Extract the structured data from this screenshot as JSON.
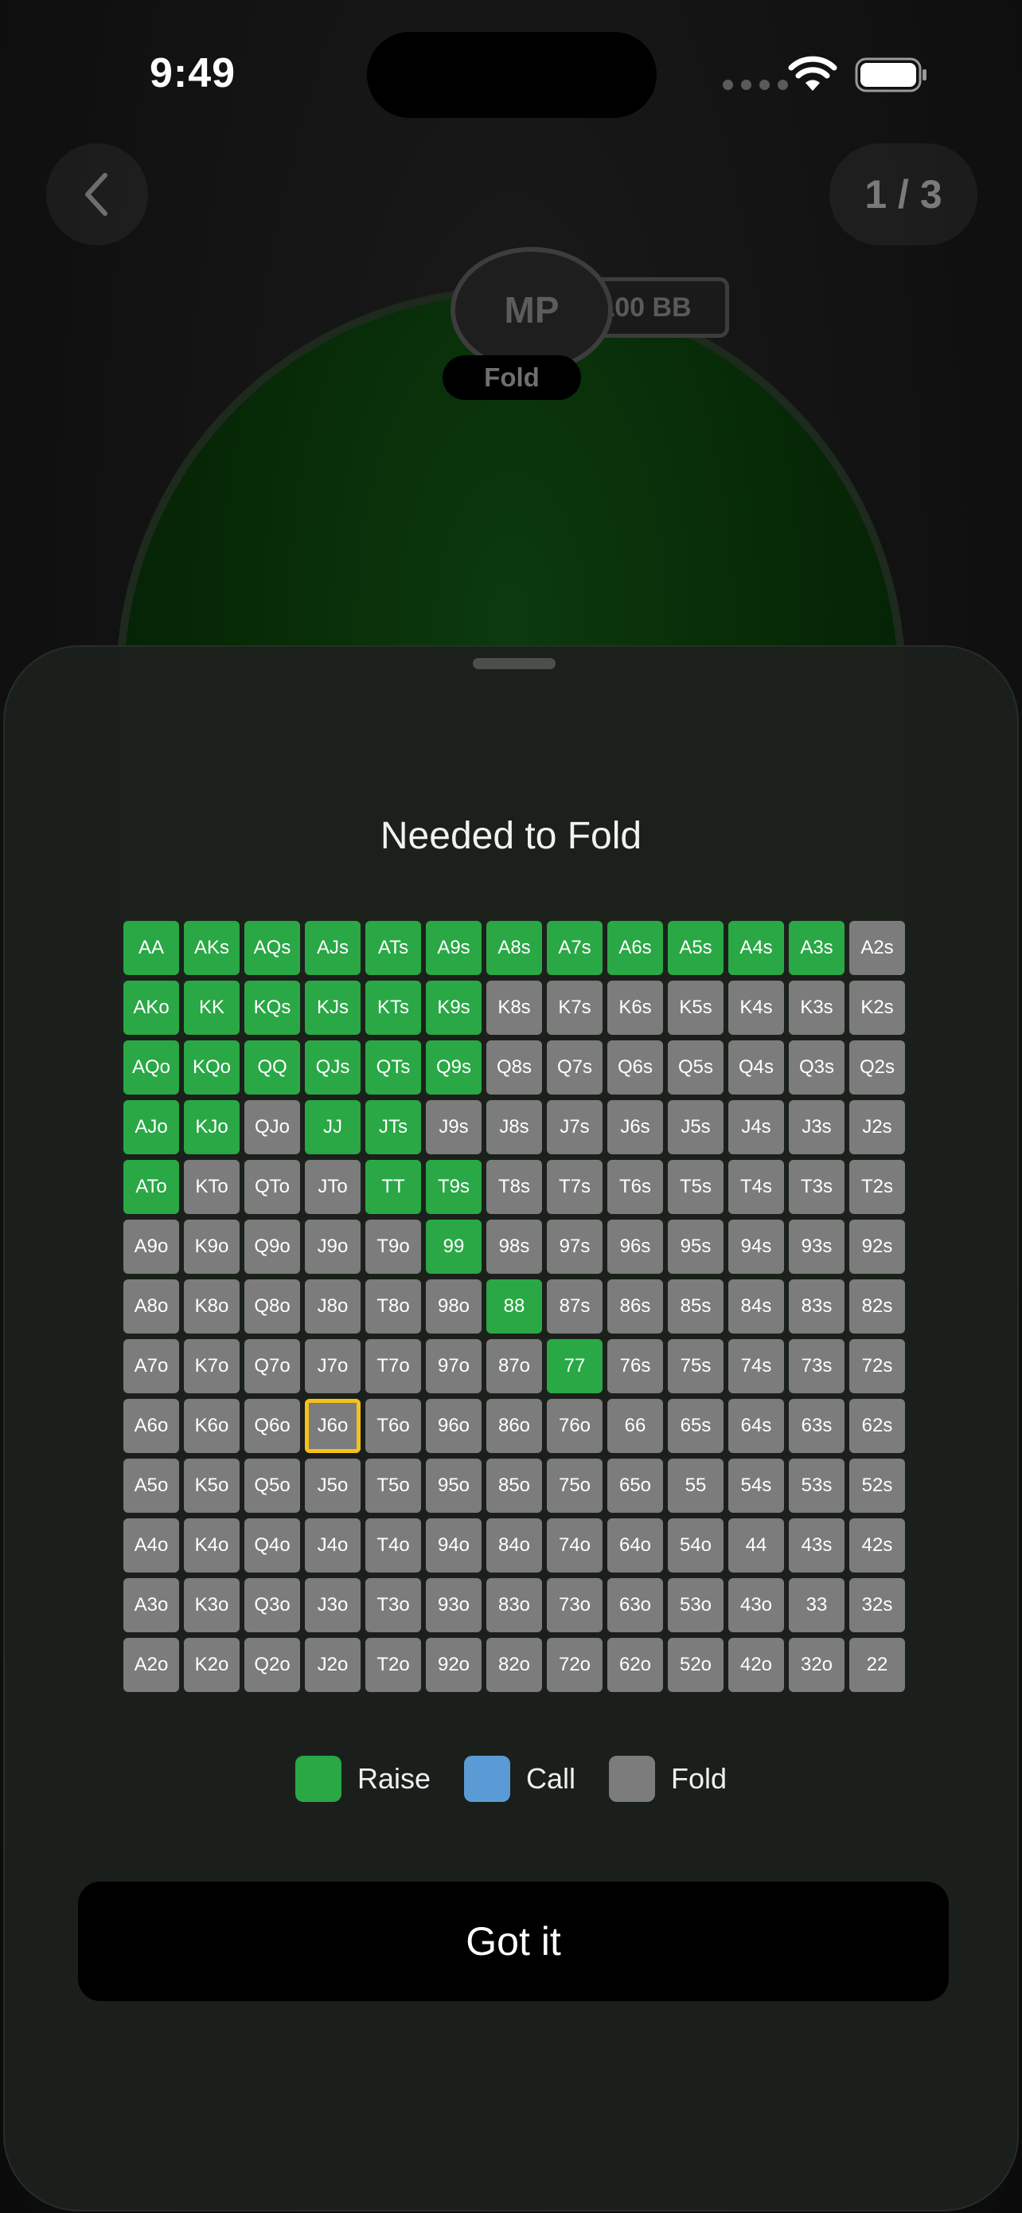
{
  "status_bar": {
    "time": "9:49"
  },
  "nav": {
    "page_counter": "1 / 3"
  },
  "table": {
    "seat_label": "MP",
    "stack": "100 BB",
    "action": "Fold"
  },
  "sheet": {
    "title": "Needed to Fold",
    "selected_hand": "J6o",
    "range_grid": [
      [
        [
          "AA",
          "raise"
        ],
        [
          "AKs",
          "raise"
        ],
        [
          "AQs",
          "raise"
        ],
        [
          "AJs",
          "raise"
        ],
        [
          "ATs",
          "raise"
        ],
        [
          "A9s",
          "raise"
        ],
        [
          "A8s",
          "raise"
        ],
        [
          "A7s",
          "raise"
        ],
        [
          "A6s",
          "raise"
        ],
        [
          "A5s",
          "raise"
        ],
        [
          "A4s",
          "raise"
        ],
        [
          "A3s",
          "raise"
        ],
        [
          "A2s",
          "fold"
        ]
      ],
      [
        [
          "AKo",
          "raise"
        ],
        [
          "KK",
          "raise"
        ],
        [
          "KQs",
          "raise"
        ],
        [
          "KJs",
          "raise"
        ],
        [
          "KTs",
          "raise"
        ],
        [
          "K9s",
          "raise"
        ],
        [
          "K8s",
          "fold"
        ],
        [
          "K7s",
          "fold"
        ],
        [
          "K6s",
          "fold"
        ],
        [
          "K5s",
          "fold"
        ],
        [
          "K4s",
          "fold"
        ],
        [
          "K3s",
          "fold"
        ],
        [
          "K2s",
          "fold"
        ]
      ],
      [
        [
          "AQo",
          "raise"
        ],
        [
          "KQo",
          "raise"
        ],
        [
          "QQ",
          "raise"
        ],
        [
          "QJs",
          "raise"
        ],
        [
          "QTs",
          "raise"
        ],
        [
          "Q9s",
          "raise"
        ],
        [
          "Q8s",
          "fold"
        ],
        [
          "Q7s",
          "fold"
        ],
        [
          "Q6s",
          "fold"
        ],
        [
          "Q5s",
          "fold"
        ],
        [
          "Q4s",
          "fold"
        ],
        [
          "Q3s",
          "fold"
        ],
        [
          "Q2s",
          "fold"
        ]
      ],
      [
        [
          "AJo",
          "raise"
        ],
        [
          "KJo",
          "raise"
        ],
        [
          "QJo",
          "fold"
        ],
        [
          "JJ",
          "raise"
        ],
        [
          "JTs",
          "raise"
        ],
        [
          "J9s",
          "fold"
        ],
        [
          "J8s",
          "fold"
        ],
        [
          "J7s",
          "fold"
        ],
        [
          "J6s",
          "fold"
        ],
        [
          "J5s",
          "fold"
        ],
        [
          "J4s",
          "fold"
        ],
        [
          "J3s",
          "fold"
        ],
        [
          "J2s",
          "fold"
        ]
      ],
      [
        [
          "ATo",
          "raise"
        ],
        [
          "KTo",
          "fold"
        ],
        [
          "QTo",
          "fold"
        ],
        [
          "JTo",
          "fold"
        ],
        [
          "TT",
          "raise"
        ],
        [
          "T9s",
          "raise"
        ],
        [
          "T8s",
          "fold"
        ],
        [
          "T7s",
          "fold"
        ],
        [
          "T6s",
          "fold"
        ],
        [
          "T5s",
          "fold"
        ],
        [
          "T4s",
          "fold"
        ],
        [
          "T3s",
          "fold"
        ],
        [
          "T2s",
          "fold"
        ]
      ],
      [
        [
          "A9o",
          "fold"
        ],
        [
          "K9o",
          "fold"
        ],
        [
          "Q9o",
          "fold"
        ],
        [
          "J9o",
          "fold"
        ],
        [
          "T9o",
          "fold"
        ],
        [
          "99",
          "raise"
        ],
        [
          "98s",
          "fold"
        ],
        [
          "97s",
          "fold"
        ],
        [
          "96s",
          "fold"
        ],
        [
          "95s",
          "fold"
        ],
        [
          "94s",
          "fold"
        ],
        [
          "93s",
          "fold"
        ],
        [
          "92s",
          "fold"
        ]
      ],
      [
        [
          "A8o",
          "fold"
        ],
        [
          "K8o",
          "fold"
        ],
        [
          "Q8o",
          "fold"
        ],
        [
          "J8o",
          "fold"
        ],
        [
          "T8o",
          "fold"
        ],
        [
          "98o",
          "fold"
        ],
        [
          "88",
          "raise"
        ],
        [
          "87s",
          "fold"
        ],
        [
          "86s",
          "fold"
        ],
        [
          "85s",
          "fold"
        ],
        [
          "84s",
          "fold"
        ],
        [
          "83s",
          "fold"
        ],
        [
          "82s",
          "fold"
        ]
      ],
      [
        [
          "A7o",
          "fold"
        ],
        [
          "K7o",
          "fold"
        ],
        [
          "Q7o",
          "fold"
        ],
        [
          "J7o",
          "fold"
        ],
        [
          "T7o",
          "fold"
        ],
        [
          "97o",
          "fold"
        ],
        [
          "87o",
          "fold"
        ],
        [
          "77",
          "raise"
        ],
        [
          "76s",
          "fold"
        ],
        [
          "75s",
          "fold"
        ],
        [
          "74s",
          "fold"
        ],
        [
          "73s",
          "fold"
        ],
        [
          "72s",
          "fold"
        ]
      ],
      [
        [
          "A6o",
          "fold"
        ],
        [
          "K6o",
          "fold"
        ],
        [
          "Q6o",
          "fold"
        ],
        [
          "J6o",
          "fold"
        ],
        [
          "T6o",
          "fold"
        ],
        [
          "96o",
          "fold"
        ],
        [
          "86o",
          "fold"
        ],
        [
          "76o",
          "fold"
        ],
        [
          "66",
          "fold"
        ],
        [
          "65s",
          "fold"
        ],
        [
          "64s",
          "fold"
        ],
        [
          "63s",
          "fold"
        ],
        [
          "62s",
          "fold"
        ]
      ],
      [
        [
          "A5o",
          "fold"
        ],
        [
          "K5o",
          "fold"
        ],
        [
          "Q5o",
          "fold"
        ],
        [
          "J5o",
          "fold"
        ],
        [
          "T5o",
          "fold"
        ],
        [
          "95o",
          "fold"
        ],
        [
          "85o",
          "fold"
        ],
        [
          "75o",
          "fold"
        ],
        [
          "65o",
          "fold"
        ],
        [
          "55",
          "fold"
        ],
        [
          "54s",
          "fold"
        ],
        [
          "53s",
          "fold"
        ],
        [
          "52s",
          "fold"
        ]
      ],
      [
        [
          "A4o",
          "fold"
        ],
        [
          "K4o",
          "fold"
        ],
        [
          "Q4o",
          "fold"
        ],
        [
          "J4o",
          "fold"
        ],
        [
          "T4o",
          "fold"
        ],
        [
          "94o",
          "fold"
        ],
        [
          "84o",
          "fold"
        ],
        [
          "74o",
          "fold"
        ],
        [
          "64o",
          "fold"
        ],
        [
          "54o",
          "fold"
        ],
        [
          "44",
          "fold"
        ],
        [
          "43s",
          "fold"
        ],
        [
          "42s",
          "fold"
        ]
      ],
      [
        [
          "A3o",
          "fold"
        ],
        [
          "K3o",
          "fold"
        ],
        [
          "Q3o",
          "fold"
        ],
        [
          "J3o",
          "fold"
        ],
        [
          "T3o",
          "fold"
        ],
        [
          "93o",
          "fold"
        ],
        [
          "83o",
          "fold"
        ],
        [
          "73o",
          "fold"
        ],
        [
          "63o",
          "fold"
        ],
        [
          "53o",
          "fold"
        ],
        [
          "43o",
          "fold"
        ],
        [
          "33",
          "fold"
        ],
        [
          "32s",
          "fold"
        ]
      ],
      [
        [
          "A2o",
          "fold"
        ],
        [
          "K2o",
          "fold"
        ],
        [
          "Q2o",
          "fold"
        ],
        [
          "J2o",
          "fold"
        ],
        [
          "T2o",
          "fold"
        ],
        [
          "92o",
          "fold"
        ],
        [
          "82o",
          "fold"
        ],
        [
          "72o",
          "fold"
        ],
        [
          "62o",
          "fold"
        ],
        [
          "52o",
          "fold"
        ],
        [
          "42o",
          "fold"
        ],
        [
          "32o",
          "fold"
        ],
        [
          "22",
          "fold"
        ]
      ]
    ],
    "legend": [
      {
        "label": "Raise",
        "color": "#29a845"
      },
      {
        "label": "Call",
        "color": "#5b9bd5"
      },
      {
        "label": "Fold",
        "color": "#7c7c7c"
      }
    ],
    "button_label": "Got it"
  },
  "icons": {
    "back": "chevron-left-icon",
    "wifi": "wifi-icon",
    "battery": "battery-icon"
  }
}
